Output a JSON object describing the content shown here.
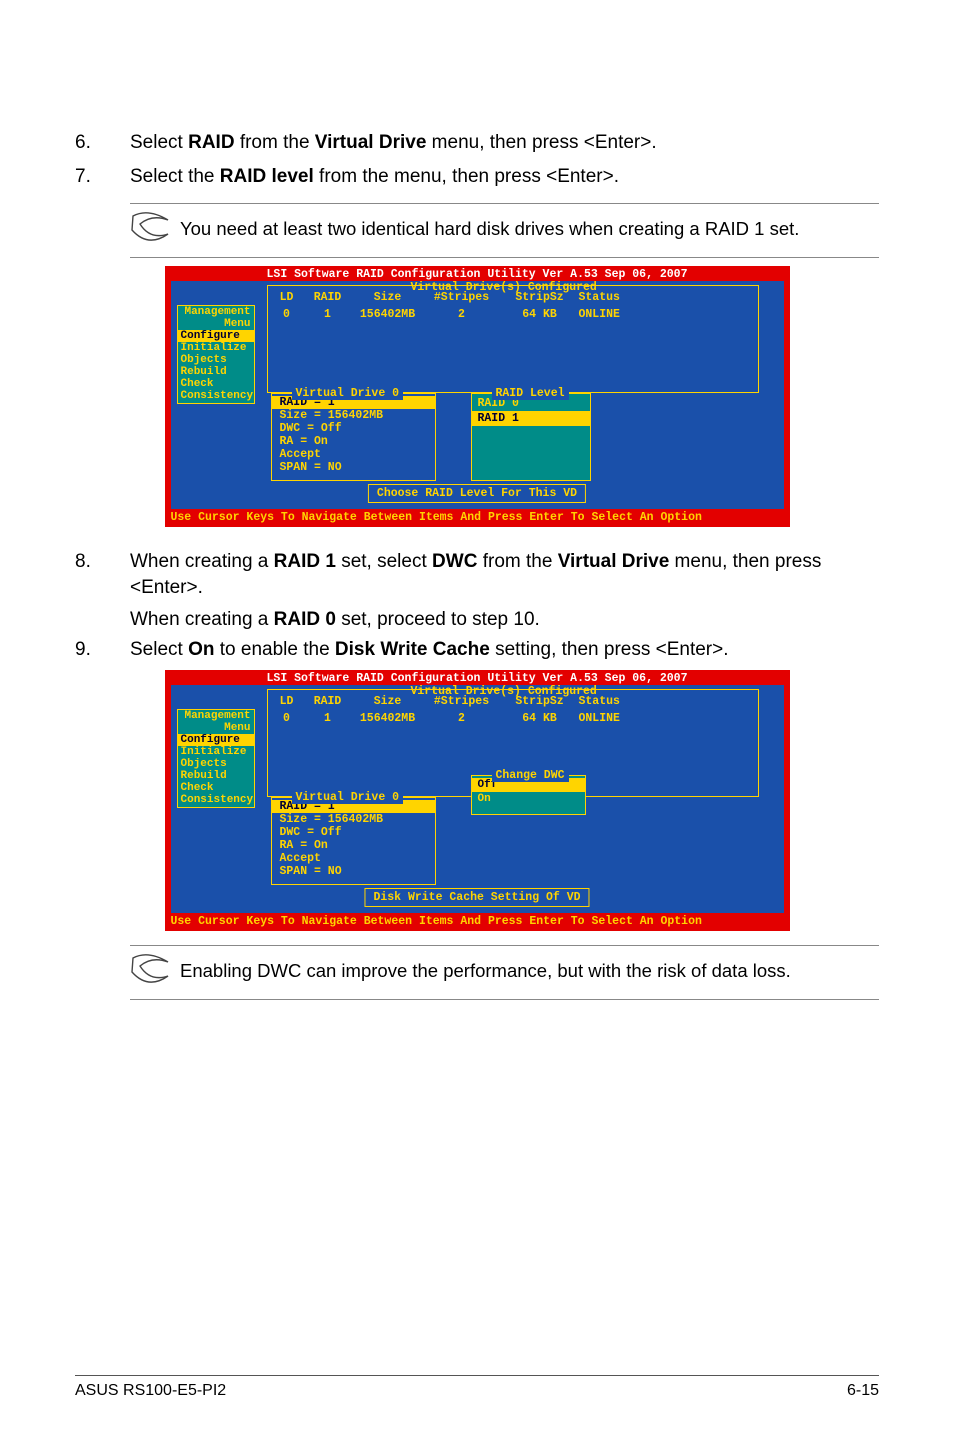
{
  "steps": {
    "s6": {
      "num": "6.",
      "pre": "Select ",
      "b1": "RAID",
      "mid": " from the ",
      "b2": "Virtual Drive",
      "post": " menu, then press <Enter>."
    },
    "s7": {
      "num": "7.",
      "pre": "Select the ",
      "b1": "RAID level",
      "post": " from the menu, then press <Enter>."
    },
    "s8": {
      "num": "8.",
      "pre": "When creating a ",
      "b1": "RAID 1",
      "mid": " set, select ",
      "b2": "DWC",
      "mid2": " from the ",
      "b3": "Virtual Drive",
      "post": " menu, then press <Enter>."
    },
    "s8b": {
      "pre": "When creating a ",
      "b1": "RAID 0",
      "post": " set, proceed to step 10."
    },
    "s9": {
      "num": "9.",
      "pre": "Select ",
      "b1": "On",
      "mid": " to enable the ",
      "b2": "Disk Write Cache",
      "post": " setting, then press <Enter>."
    }
  },
  "note1": "You need at least two identical hard disk drives when creating a RAID 1 set.",
  "note2": "Enabling DWC can improve the performance, but with the risk of data loss.",
  "bios": {
    "title": "LSI Software RAID Configuration Utility Ver A.53 Sep 06, 2007",
    "vdconf": "Virtual Drive(s) Configured",
    "headers": {
      "ld": "LD",
      "raid": "RAID",
      "size": "Size",
      "stripes": "#Stripes",
      "stripsz": "StripSz",
      "status": "Status"
    },
    "row": {
      "ld": "0",
      "raid": "1",
      "size": "156402MB",
      "stripes": "2",
      "stripsz": "64 KB",
      "status": "ONLINE"
    },
    "sidemenu": {
      "m0": "Management Menu",
      "m1": "Configure",
      "m2": "Initialize",
      "m3": "Objects",
      "m4": "Rebuild",
      "m5": "Check Consistency"
    },
    "vd0": {
      "title": "Virtual Drive 0",
      "l1": "RAID = 1",
      "l2": "Size = 156402MB",
      "l3": "DWC  = Off",
      "l4": "RA   = On",
      "l5": "Accept",
      "l6": "SPAN = NO"
    },
    "raidlvl": {
      "title": "RAID Level",
      "o1": "RAID 0",
      "o2": "RAID 1"
    },
    "help1": "Choose RAID Level For This VD",
    "chdwc": {
      "title": "Change DWC",
      "o1": "Off",
      "o2": "On"
    },
    "help2": "Disk Write Cache Setting Of VD",
    "footer": "Use Cursor Keys To Navigate Between Items And Press Enter To Select An Option"
  },
  "footer": {
    "left": "ASUS RS100-E5-PI2",
    "right": "6-15"
  }
}
